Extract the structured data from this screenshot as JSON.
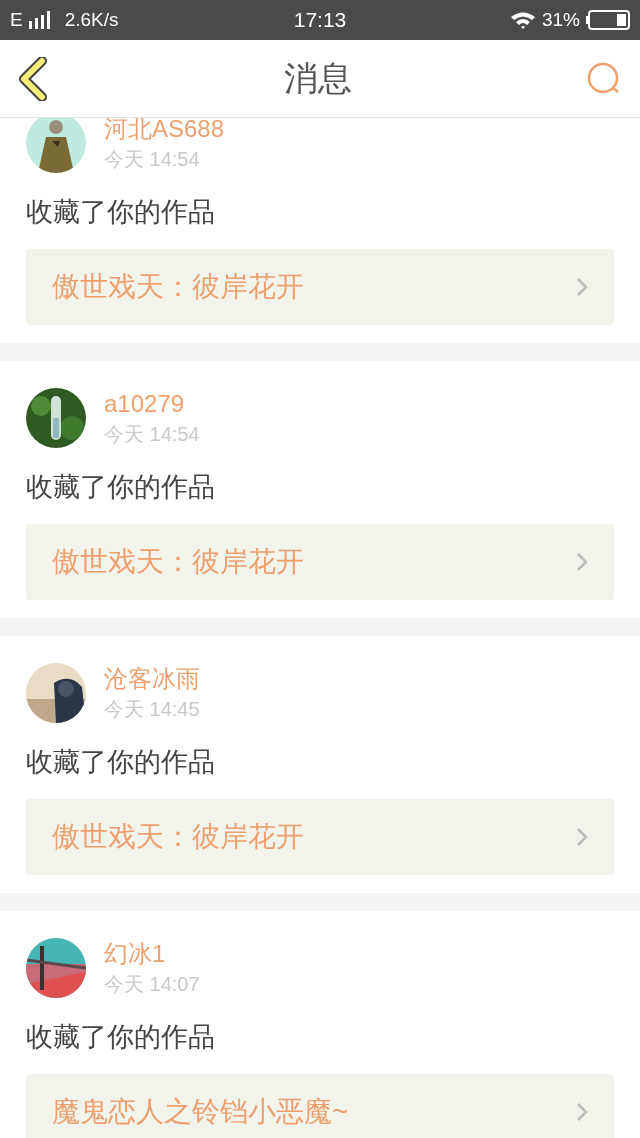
{
  "status_bar": {
    "network": "E",
    "speed": "2.6K/s",
    "time": "17:13",
    "battery": "31%"
  },
  "header": {
    "title": "消息"
  },
  "messages": [
    {
      "user": "河北AS688",
      "time": "今天 14:54",
      "action": "收藏了你的作品",
      "work": "傲世戏天：彼岸花开"
    },
    {
      "user": "a10279",
      "time": "今天 14:54",
      "action": "收藏了你的作品",
      "work": "傲世戏天：彼岸花开"
    },
    {
      "user": "沧客冰雨",
      "time": "今天 14:45",
      "action": "收藏了你的作品",
      "work": "傲世戏天：彼岸花开"
    },
    {
      "user": "幻冰1",
      "time": "今天 14:07",
      "action": "收藏了你的作品",
      "work": "魔鬼恋人之铃铛小恶魔~"
    }
  ]
}
